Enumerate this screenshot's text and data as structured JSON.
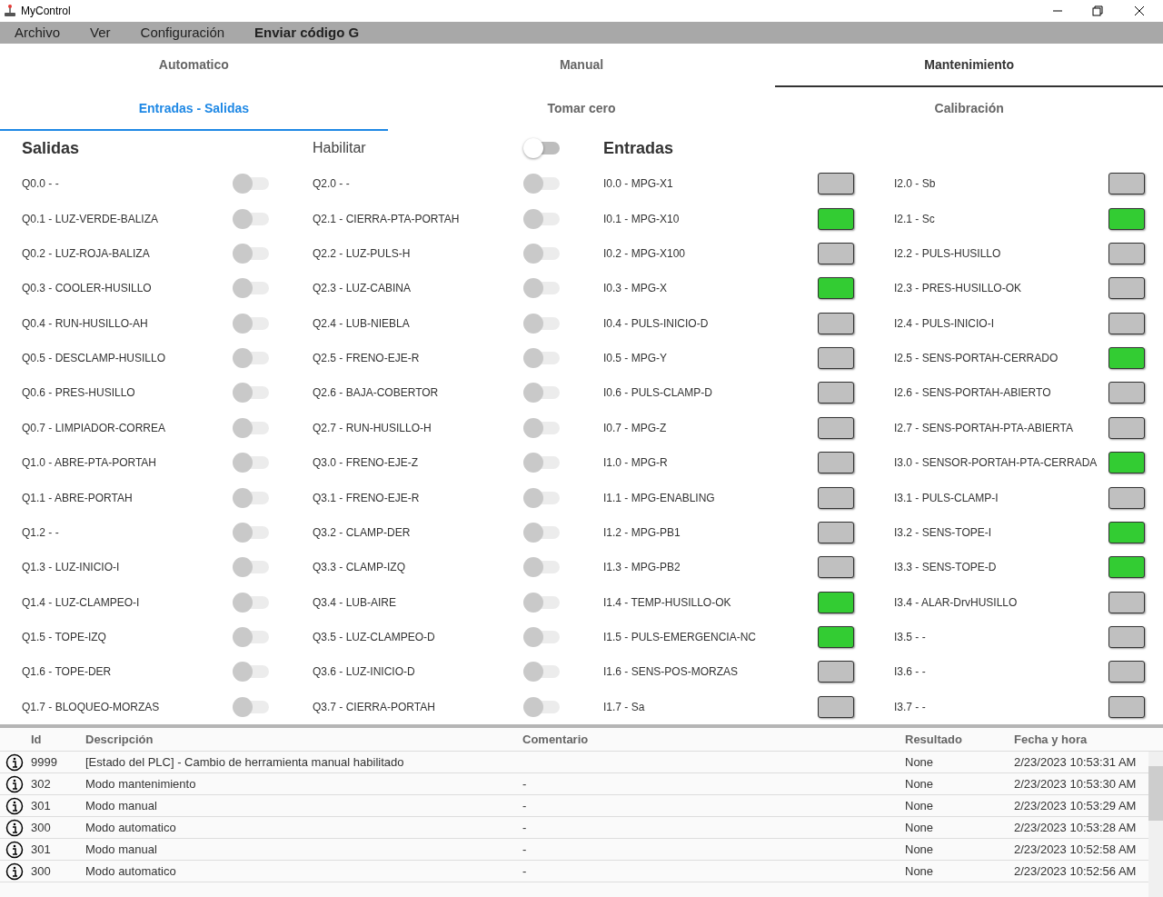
{
  "window": {
    "title": "MyControl"
  },
  "menu": [
    {
      "label": "Archivo",
      "bold": false
    },
    {
      "label": "Ver",
      "bold": false
    },
    {
      "label": "Configuración",
      "bold": false
    },
    {
      "label": "Enviar código G",
      "bold": true
    }
  ],
  "mode_tabs": [
    {
      "label": "Automatico",
      "selected": false
    },
    {
      "label": "Manual",
      "selected": false
    },
    {
      "label": "Mantenimiento",
      "selected": true
    }
  ],
  "sub_tabs": [
    {
      "label": "Entradas - Salidas",
      "selected": true
    },
    {
      "label": "Tomar cero",
      "selected": false
    },
    {
      "label": "Calibración",
      "selected": false
    }
  ],
  "salidas": {
    "title": "Salidas",
    "columns": [
      {
        "items": [
          {
            "label": "Q0.0 - -",
            "on": false
          },
          {
            "label": "Q0.1 - LUZ-VERDE-BALIZA",
            "on": false
          },
          {
            "label": "Q0.2 - LUZ-ROJA-BALIZA",
            "on": false
          },
          {
            "label": "Q0.3 - COOLER-HUSILLO",
            "on": false
          },
          {
            "label": "Q0.4 - RUN-HUSILLO-AH",
            "on": false
          },
          {
            "label": "Q0.5 - DESCLAMP-HUSILLO",
            "on": false
          },
          {
            "label": "Q0.6 - PRES-HUSILLO",
            "on": false
          },
          {
            "label": "Q0.7 - LIMPIADOR-CORREA",
            "on": false
          },
          {
            "label": "Q1.0 - ABRE-PTA-PORTAH",
            "on": false
          },
          {
            "label": "Q1.1 - ABRE-PORTAH",
            "on": false
          },
          {
            "label": "Q1.2 - -",
            "on": false
          },
          {
            "label": "Q1.3 - LUZ-INICIO-I",
            "on": false
          },
          {
            "label": "Q1.4 - LUZ-CLAMPEO-I",
            "on": false
          },
          {
            "label": "Q1.5 - TOPE-IZQ",
            "on": false
          },
          {
            "label": "Q1.6 - TOPE-DER",
            "on": false
          },
          {
            "label": "Q1.7 - BLOQUEO-MORZAS",
            "on": false
          }
        ]
      },
      {
        "items": [
          {
            "label": "Q2.0 - -",
            "on": false
          },
          {
            "label": "Q2.1 - CIERRA-PTA-PORTAH",
            "on": false
          },
          {
            "label": "Q2.2 - LUZ-PULS-H",
            "on": false
          },
          {
            "label": "Q2.3 - LUZ-CABINA",
            "on": false
          },
          {
            "label": "Q2.4 - LUB-NIEBLA",
            "on": false
          },
          {
            "label": "Q2.5 - FRENO-EJE-R",
            "on": false
          },
          {
            "label": "Q2.6 - BAJA-COBERTOR",
            "on": false
          },
          {
            "label": "Q2.7 - RUN-HUSILLO-H",
            "on": false
          },
          {
            "label": "Q3.0 - FRENO-EJE-Z",
            "on": false
          },
          {
            "label": "Q3.1 - FRENO-EJE-R",
            "on": false
          },
          {
            "label": "Q3.2 - CLAMP-DER",
            "on": false
          },
          {
            "label": "Q3.3 - CLAMP-IZQ",
            "on": false
          },
          {
            "label": "Q3.4 - LUB-AIRE",
            "on": false
          },
          {
            "label": "Q3.5 - LUZ-CLAMPEO-D",
            "on": false
          },
          {
            "label": "Q3.6 - LUZ-INICIO-D",
            "on": false
          },
          {
            "label": "Q3.7 - CIERRA-PORTAH",
            "on": false
          }
        ]
      }
    ]
  },
  "habilitar": {
    "label": "Habilitar",
    "on": false
  },
  "entradas": {
    "title": "Entradas",
    "columns": [
      {
        "items": [
          {
            "label": "I0.0 - MPG-X1",
            "active": false
          },
          {
            "label": "I0.1 - MPG-X10",
            "active": true
          },
          {
            "label": "I0.2 - MPG-X100",
            "active": false
          },
          {
            "label": "I0.3 - MPG-X",
            "active": true
          },
          {
            "label": "I0.4 - PULS-INICIO-D",
            "active": false
          },
          {
            "label": "I0.5 - MPG-Y",
            "active": false
          },
          {
            "label": "I0.6 - PULS-CLAMP-D",
            "active": false
          },
          {
            "label": "I0.7 - MPG-Z",
            "active": false
          },
          {
            "label": "I1.0 - MPG-R",
            "active": false
          },
          {
            "label": "I1.1 - MPG-ENABLING",
            "active": false
          },
          {
            "label": "I1.2 - MPG-PB1",
            "active": false
          },
          {
            "label": "I1.3 - MPG-PB2",
            "active": false
          },
          {
            "label": "I1.4 - TEMP-HUSILLO-OK",
            "active": true
          },
          {
            "label": "I1.5 - PULS-EMERGENCIA-NC",
            "active": true
          },
          {
            "label": "I1.6 - SENS-POS-MORZAS",
            "active": false
          },
          {
            "label": "I1.7 - Sa",
            "active": false
          }
        ]
      },
      {
        "items": [
          {
            "label": "I2.0 - Sb",
            "active": false
          },
          {
            "label": "I2.1 - Sc",
            "active": true
          },
          {
            "label": "I2.2 - PULS-HUSILLO",
            "active": false
          },
          {
            "label": "I2.3 - PRES-HUSILLO-OK",
            "active": false
          },
          {
            "label": "I2.4 - PULS-INICIO-I",
            "active": false
          },
          {
            "label": "I2.5 - SENS-PORTAH-CERRADO",
            "active": true
          },
          {
            "label": "I2.6 - SENS-PORTAH-ABIERTO",
            "active": false
          },
          {
            "label": "I2.7 - SENS-PORTAH-PTA-ABIERTA",
            "active": false
          },
          {
            "label": "I3.0 - SENSOR-PORTAH-PTA-CERRADA",
            "active": true
          },
          {
            "label": "I3.1 - PULS-CLAMP-I",
            "active": false
          },
          {
            "label": "I3.2 - SENS-TOPE-I",
            "active": true
          },
          {
            "label": "I3.3 - SENS-TOPE-D",
            "active": true
          },
          {
            "label": "I3.4 - ALAR-DrvHUSILLO",
            "active": false
          },
          {
            "label": "I3.5 - -",
            "active": false
          },
          {
            "label": "I3.6 - -",
            "active": false
          },
          {
            "label": "I3.7 - -",
            "active": false
          }
        ]
      }
    ]
  },
  "log": {
    "columns": [
      "Id",
      "Descripción",
      "Comentario",
      "Resultado",
      "Fecha y hora"
    ],
    "rows": [
      {
        "id": "9999",
        "description": "[Estado del PLC] - Cambio de herramienta manual habilitado",
        "comment": "",
        "result": "None",
        "datetime": "2/23/2023 10:53:31 AM"
      },
      {
        "id": "302",
        "description": "Modo mantenimiento",
        "comment": "-",
        "result": "None",
        "datetime": "2/23/2023 10:53:30 AM"
      },
      {
        "id": "301",
        "description": "Modo manual",
        "comment": "-",
        "result": "None",
        "datetime": "2/23/2023 10:53:29 AM"
      },
      {
        "id": "300",
        "description": "Modo automatico",
        "comment": "-",
        "result": "None",
        "datetime": "2/23/2023 10:53:28 AM"
      },
      {
        "id": "301",
        "description": "Modo manual",
        "comment": "-",
        "result": "None",
        "datetime": "2/23/2023 10:52:58 AM"
      },
      {
        "id": "300",
        "description": "Modo automatico",
        "comment": "-",
        "result": "None",
        "datetime": "2/23/2023 10:52:56 AM"
      }
    ]
  }
}
